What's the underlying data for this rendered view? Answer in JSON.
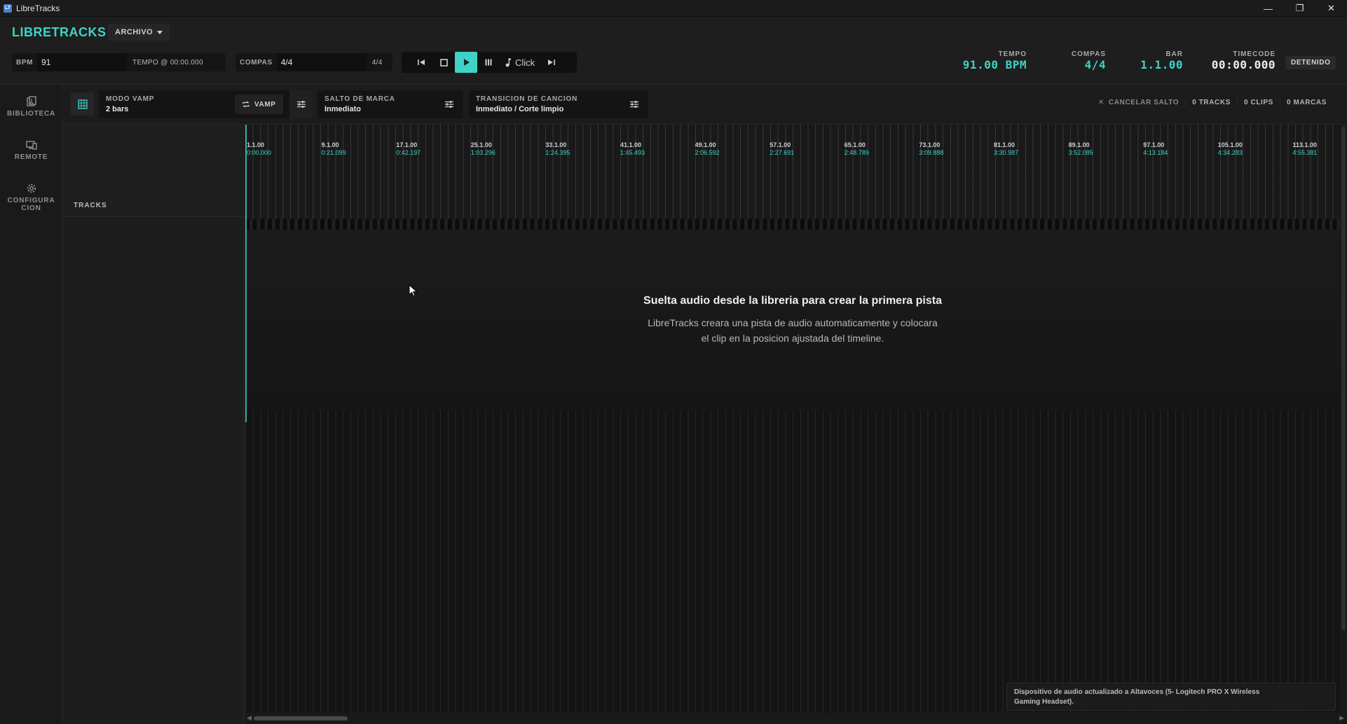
{
  "window": {
    "title": "LibreTracks",
    "controls": [
      "minimize",
      "restore",
      "close"
    ]
  },
  "header": {
    "logo": "LIBRETRACKS",
    "menu_archivo": "ARCHIVO",
    "bpm": {
      "label": "BPM",
      "value": "91",
      "tempo_label": "TEMPO @ 00:00.000"
    },
    "compas": {
      "label": "COMPAS",
      "value": "4/4",
      "extra": "4/4"
    },
    "transport": {
      "buttons": [
        "skip-back",
        "stop",
        "play",
        "pause",
        "click",
        "skip-forward"
      ],
      "click_label": "Click",
      "playing_color": "#3fd3c7"
    },
    "readouts": {
      "tempo": {
        "label": "TEMPO",
        "value": "91.00 BPM"
      },
      "compas": {
        "label": "COMPAS",
        "value": "4/4"
      },
      "bar": {
        "label": "BAR",
        "value": "1.1.00"
      },
      "timecode": {
        "label": "TIMECODE",
        "value": "00:00.000"
      }
    },
    "status": "DETENIDO"
  },
  "rail": {
    "items": [
      {
        "label_1": "BIBLIOTECA",
        "label_2": "",
        "icon": "library-icon"
      },
      {
        "label_1": "REMOTE",
        "label_2": "",
        "icon": "remote-icon"
      },
      {
        "label_1": "CONFIGURA",
        "label_2": "CION",
        "icon": "gear-icon"
      }
    ]
  },
  "modebar": {
    "vamp": {
      "label": "MODO VAMP",
      "value": "2 bars",
      "button": "VAMP"
    },
    "salto": {
      "label": "SALTO DE MARCA",
      "value": "Inmediato"
    },
    "transicion": {
      "label": "TRANSICION DE CANCION",
      "value": "Inmediato / Corte limpio"
    },
    "cancel": "CANCELAR SALTO",
    "tracks_count": "0 TRACKS",
    "clips_count": "0 CLIPS",
    "marks_count": "0 MARCAS"
  },
  "tracks_header": "TRACKS",
  "ruler": {
    "marks": [
      {
        "bar": "1.1.00",
        "time": "0:00.000"
      },
      {
        "bar": "9.1.00",
        "time": "0:21.099"
      },
      {
        "bar": "17.1.00",
        "time": "0:42.197"
      },
      {
        "bar": "25.1.00",
        "time": "1:03.296"
      },
      {
        "bar": "33.1.00",
        "time": "1:24.395"
      },
      {
        "bar": "41.1.00",
        "time": "1:45.493"
      },
      {
        "bar": "49.1.00",
        "time": "2:06.592"
      },
      {
        "bar": "57.1.00",
        "time": "2:27.691"
      },
      {
        "bar": "65.1.00",
        "time": "2:48.789"
      },
      {
        "bar": "73.1.00",
        "time": "3:09.888"
      },
      {
        "bar": "81.1.00",
        "time": "3:30.987"
      },
      {
        "bar": "89.1.00",
        "time": "3:52.085"
      },
      {
        "bar": "97.1.00",
        "time": "4:13.184"
      },
      {
        "bar": "105.1.00",
        "time": "4:34.283"
      },
      {
        "bar": "113.1.00",
        "time": "4:55.381"
      }
    ]
  },
  "empty_state": {
    "title": "Suelta audio desde la libreria para crear la primera pista",
    "line1": "LibreTracks creara una pista de audio automaticamente y colocara",
    "line2": "el clip en la posicion ajustada del timeline."
  },
  "toast": {
    "line1": "Dispositivo de audio actualizado a Altavoces (5- Logitech PRO X Wireless",
    "line2": "Gaming Headset)."
  }
}
